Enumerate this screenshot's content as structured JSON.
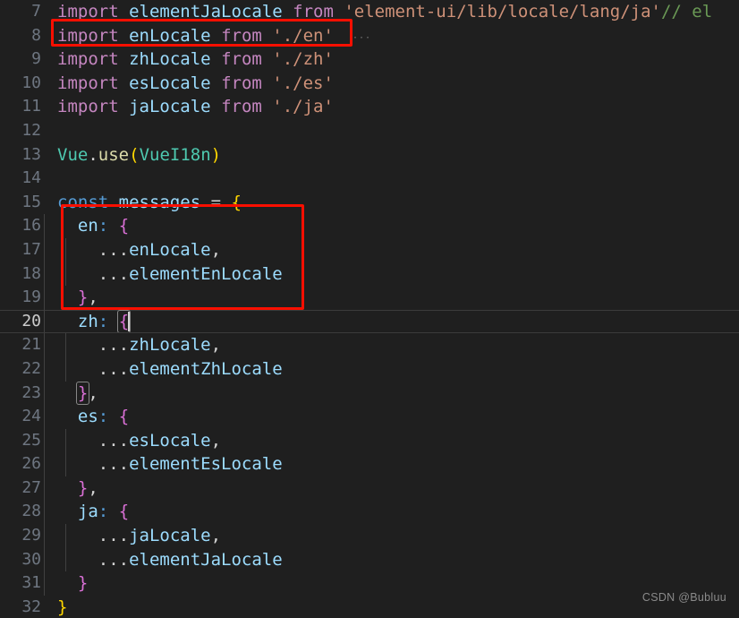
{
  "editor": {
    "background_color": "#1f1f1f",
    "line_number_color": "#6e7681",
    "active_line_number": 20,
    "first_visible_line": 7,
    "last_visible_line": 32,
    "colors": {
      "keyword": "#c586c0",
      "declaration": "#569cd6",
      "identifier": "#9cdcfe",
      "string": "#ce9178",
      "comment": "#6a9955",
      "type": "#4ec9b0",
      "function": "#dcdcaa",
      "bracket_level_1": "#ffd700",
      "bracket_level_2": "#da70d6",
      "punctuation": "#d4d4d4",
      "annotation_red": "#fa0f00"
    },
    "lines": [
      {
        "num": "7",
        "text": "import elementJaLocale from 'element-ui/lib/locale/lang/ja'// el"
      },
      {
        "num": "8",
        "text": "import enLocale from './en'"
      },
      {
        "num": "9",
        "text": "import zhLocale from './zh'"
      },
      {
        "num": "10",
        "text": "import esLocale from './es'"
      },
      {
        "num": "11",
        "text": "import jaLocale from './ja'"
      },
      {
        "num": "12",
        "text": ""
      },
      {
        "num": "13",
        "text": "Vue.use(VueI18n)"
      },
      {
        "num": "14",
        "text": ""
      },
      {
        "num": "15",
        "text": "const messages = {"
      },
      {
        "num": "16",
        "text": "  en: {"
      },
      {
        "num": "17",
        "text": "    ...enLocale,"
      },
      {
        "num": "18",
        "text": "    ...elementEnLocale"
      },
      {
        "num": "19",
        "text": "  },"
      },
      {
        "num": "20",
        "text": "  zh: {"
      },
      {
        "num": "21",
        "text": "    ...zhLocale,"
      },
      {
        "num": "22",
        "text": "    ...elementZhLocale"
      },
      {
        "num": "23",
        "text": "  },"
      },
      {
        "num": "24",
        "text": "  es: {"
      },
      {
        "num": "25",
        "text": "    ...esLocale,"
      },
      {
        "num": "26",
        "text": "    ...elementEsLocale"
      },
      {
        "num": "27",
        "text": "  },"
      },
      {
        "num": "28",
        "text": "  ja: {"
      },
      {
        "num": "29",
        "text": "    ...jaLocale,"
      },
      {
        "num": "30",
        "text": "    ...elementJaLocale"
      },
      {
        "num": "31",
        "text": "  }"
      },
      {
        "num": "32",
        "text": "}"
      }
    ],
    "tokens": {
      "import": "import",
      "from": "from",
      "const": "const",
      "elementJaLocale": "elementJaLocale",
      "enLocale": "enLocale",
      "zhLocale": "zhLocale",
      "esLocale": "esLocale",
      "jaLocale": "jaLocale",
      "elementEnLocale": "elementEnLocale",
      "elementZhLocale": "elementZhLocale",
      "elementEsLocale": "elementEsLocale",
      "elementJaLocaleSpread": "elementJaLocale",
      "path_elementui_ja": "'element-ui/lib/locale/lang/ja'",
      "comment_el": "// el",
      "path_en": "'./en'",
      "path_zh": "'./zh'",
      "path_es": "'./es'",
      "path_ja": "'./ja'",
      "vue": "Vue",
      "dot": ".",
      "use": "use",
      "paren_open": "(",
      "vuei18n": "VueI18n",
      "paren_close": ")",
      "messages": "messages",
      "equals": "=",
      "brace_open": "{",
      "brace_close": "}",
      "comma": ",",
      "colon": ":",
      "spread": "...",
      "key_en": "en",
      "key_zh": "zh",
      "key_es": "es",
      "key_ja": "ja",
      "continuation_dots": "···"
    }
  },
  "annotations": [
    {
      "id": "annot-import",
      "target_line": "8",
      "label": "highlight-import-enlocale"
    },
    {
      "id": "annot-en",
      "target_line": "16-19",
      "label": "highlight-en-messages-block"
    }
  ],
  "watermark": {
    "text": "CSDN @Bubluu"
  }
}
